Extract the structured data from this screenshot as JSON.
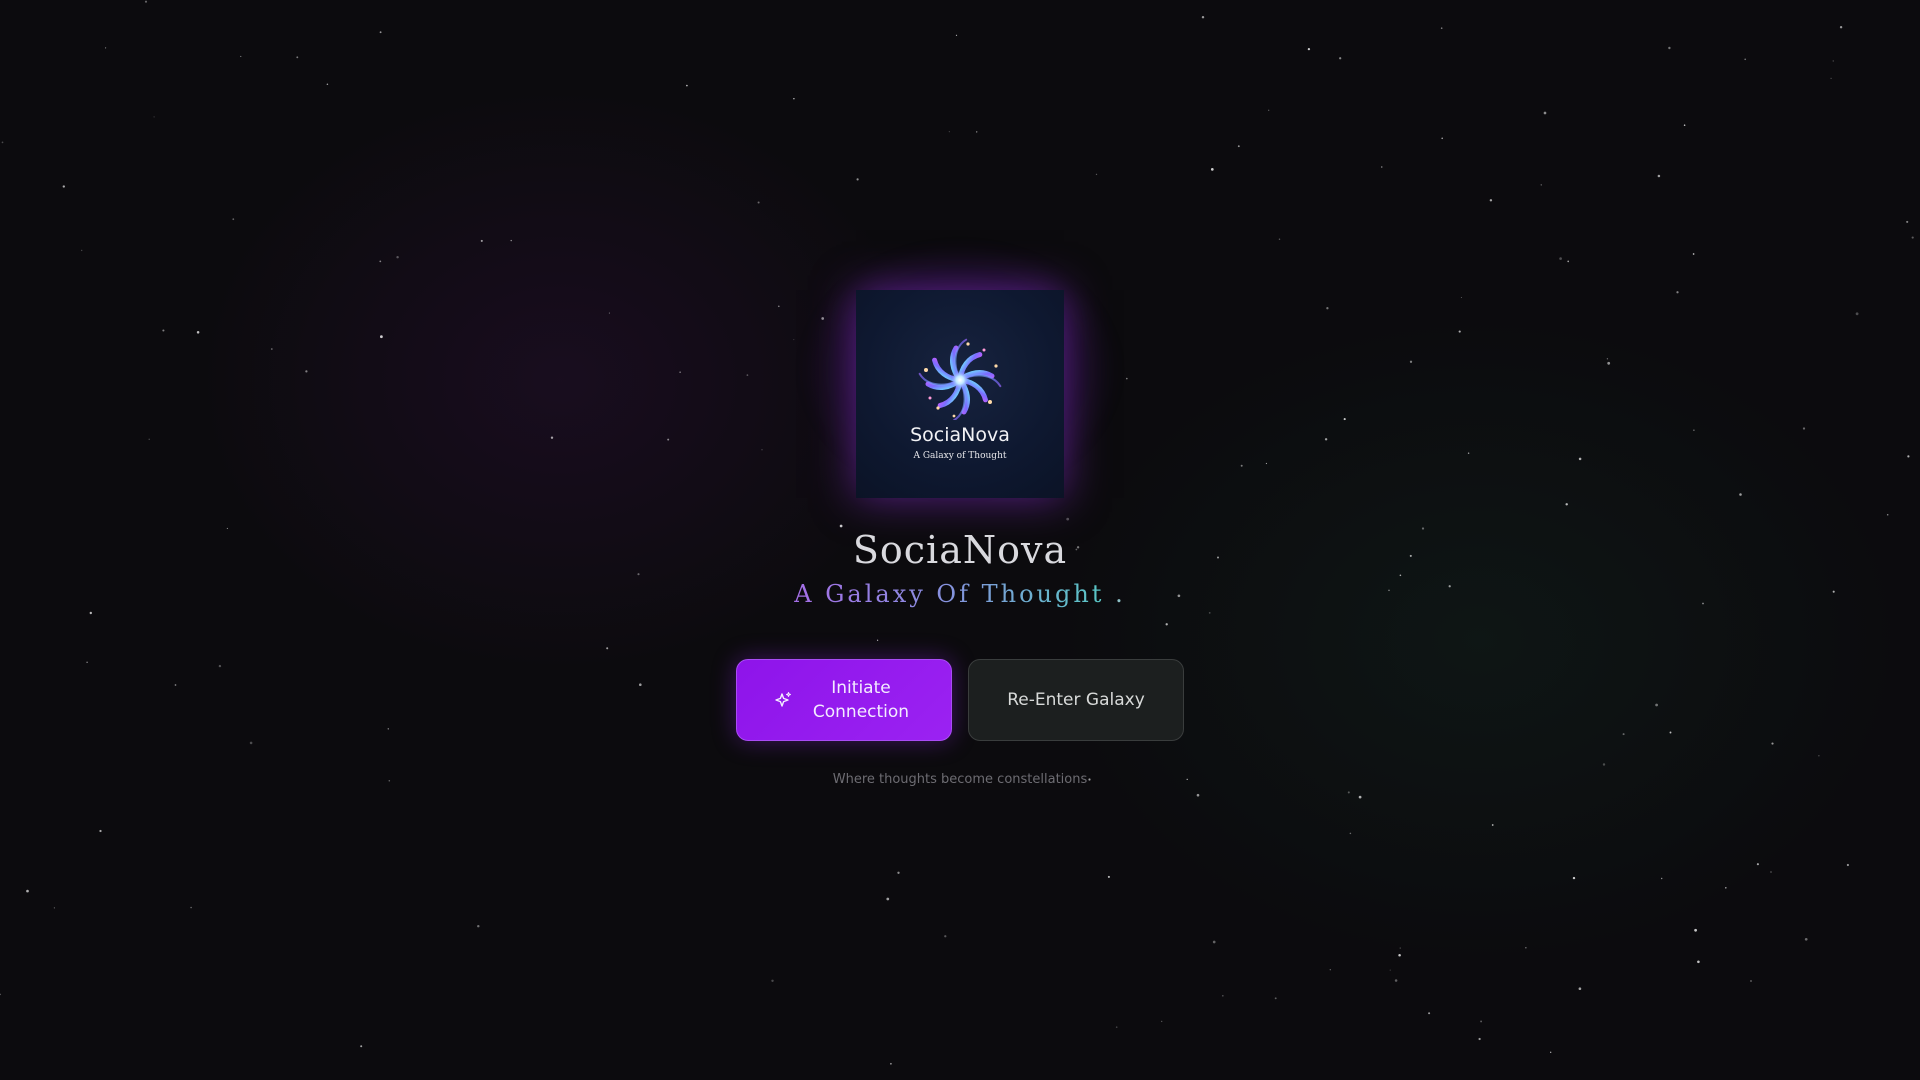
{
  "logo": {
    "name": "SociaNova",
    "tagline": "A Galaxy of Thought",
    "icon": "spiral-galaxy-icon"
  },
  "hero": {
    "title": "SociaNova",
    "subtitle": "A Galaxy Of Thought",
    "subtitle_suffix": "."
  },
  "actions": {
    "primary_label": "Initiate Connection",
    "primary_icon": "sparkle-icon",
    "secondary_label": "Re-Enter Galaxy"
  },
  "footer": {
    "tagline": "Where thoughts become constellations"
  },
  "colors": {
    "background": "#0c0b0e",
    "primary_button": "#9b22f2",
    "secondary_button": "#1c1f1f",
    "subtitle_start": "#a56ee6",
    "subtitle_end": "#58c7c4"
  }
}
